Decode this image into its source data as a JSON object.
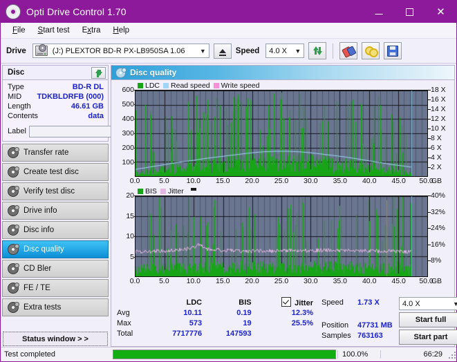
{
  "window": {
    "title": "Opti Drive Control 1.70",
    "icon": "disc-icon",
    "minimize": "–",
    "maximize": "□",
    "close": "✕",
    "accent_color": "#8d1a9b"
  },
  "menu": [
    {
      "label": "File",
      "accel": "F"
    },
    {
      "label": "Start test",
      "accel": "S"
    },
    {
      "label": "Extra",
      "accel": "x"
    },
    {
      "label": "Help",
      "accel": "H"
    }
  ],
  "toolbar": {
    "drive_label": "Drive",
    "drive_value": "(J:)  PLEXTOR BD-R  PX-LB950SA 1.06",
    "drive_icon": "drive-icon",
    "eject_icon": "eject-icon",
    "speed_label": "Speed",
    "speed_value": "4.0 X",
    "refresh_icon": "refresh-icon",
    "erase_icon": "eraser-icon",
    "bitsetting_icon": "bitsetting-icon",
    "save_icon": "save-icon"
  },
  "disc": {
    "title": "Disc",
    "refresh_icon": "refresh-icon",
    "rows": [
      {
        "key": "Type",
        "value": "BD-R DL"
      },
      {
        "key": "MID",
        "value": "TDKBLDRFB (000)"
      },
      {
        "key": "Length",
        "value": "46.61 GB"
      },
      {
        "key": "Contents",
        "value": "data"
      }
    ],
    "label_key": "Label",
    "label_value": "",
    "label_placeholder": "",
    "label_button_icon": "disc-icon"
  },
  "nav": {
    "items": [
      {
        "label": "Transfer rate",
        "icon": "disc-icon",
        "selected": false
      },
      {
        "label": "Create test disc",
        "icon": "disc-icon",
        "selected": false
      },
      {
        "label": "Verify test disc",
        "icon": "disc-icon",
        "selected": false
      },
      {
        "label": "Drive info",
        "icon": "disc-icon",
        "selected": false
      },
      {
        "label": "Disc info",
        "icon": "disc-icon",
        "selected": false
      },
      {
        "label": "Disc quality",
        "icon": "disc-icon",
        "selected": true
      },
      {
        "label": "CD Bler",
        "icon": "disc-icon",
        "selected": false
      },
      {
        "label": "FE / TE",
        "icon": "disc-icon",
        "selected": false
      },
      {
        "label": "Extra tests",
        "icon": "disc-icon",
        "selected": false
      }
    ],
    "status_window": "Status window > >"
  },
  "pane": {
    "title": "Disc quality",
    "icon": "disc-icon"
  },
  "chart_data": [
    {
      "type": "line",
      "title": "LDC / Read speed",
      "legend": [
        {
          "label": "LDC",
          "color": "#17a517"
        },
        {
          "label": "Read speed",
          "color": "#9fd6f5"
        },
        {
          "label": "Write speed",
          "color": "#f48fd8"
        }
      ],
      "legend_position": "top-left",
      "grid": true,
      "xlabel": "GB",
      "x_ticks": [
        "0.0",
        "5.0",
        "10.0",
        "15.0",
        "20.0",
        "25.0",
        "30.0",
        "35.0",
        "40.0",
        "45.0",
        "50.0"
      ],
      "xlim": [
        0,
        50
      ],
      "ylabel_left": "LDC",
      "y_ticks_left": [
        "100",
        "200",
        "300",
        "400",
        "500",
        "600"
      ],
      "ylim_left": [
        0,
        600
      ],
      "ylabel_right": "Speed",
      "y_ticks_right": [
        "2 X",
        "4 X",
        "6 X",
        "8 X",
        "10 X",
        "12 X",
        "14 X",
        "16 X",
        "18 X"
      ],
      "ylim_right": [
        0,
        18
      ],
      "x_unit": "GB",
      "series": [
        {
          "name": "Read speed",
          "color": "#9fd6f5",
          "x": [
            0,
            2,
            4,
            6,
            8,
            10,
            12,
            14,
            16,
            18,
            20,
            22,
            24,
            26,
            28,
            30,
            32,
            34,
            36,
            38,
            40,
            42,
            44,
            46,
            47
          ],
          "values": [
            1.5,
            1.9,
            2.3,
            2.7,
            3.1,
            3.4,
            3.8,
            4.1,
            4.4,
            4.7,
            5.0,
            5.2,
            5.3,
            5.3,
            5.2,
            5.0,
            4.7,
            4.4,
            4.1,
            3.7,
            3.3,
            2.9,
            2.5,
            2.2,
            2.0
          ]
        },
        {
          "name": "LDC",
          "color": "#17a517",
          "note": "dense per-sample error bars, baseline ~10, spikes up to 573"
        }
      ],
      "cursor_x": 47.3,
      "cursor_color": "#29c6f0"
    },
    {
      "type": "line",
      "title": "BIS / Jitter",
      "legend": [
        {
          "label": "BIS",
          "color": "#17a517"
        },
        {
          "label": "Jitter",
          "color": "#e3b7e0"
        }
      ],
      "legend_position": "top-left",
      "grid": true,
      "xlabel": "GB",
      "x_ticks": [
        "0.0",
        "5.0",
        "10.0",
        "15.0",
        "20.0",
        "25.0",
        "30.0",
        "35.0",
        "40.0",
        "45.0",
        "50.0"
      ],
      "xlim": [
        0,
        50
      ],
      "ylabel_left": "BIS",
      "y_ticks_left": [
        "5",
        "10",
        "15",
        "20"
      ],
      "ylim_left": [
        0,
        20
      ],
      "ylabel_right": "Jitter",
      "y_ticks_right": [
        "8%",
        "16%",
        "24%",
        "32%",
        "40%"
      ],
      "ylim_right": [
        0,
        40
      ],
      "x_unit": "GB",
      "series": [
        {
          "name": "Jitter",
          "color": "#e3b7e0",
          "x": [
            0,
            2,
            4,
            6,
            8,
            10,
            11,
            12,
            14,
            16,
            18,
            20,
            22,
            24,
            26,
            28,
            30,
            32,
            34,
            36,
            38,
            40,
            42,
            44,
            46,
            47
          ],
          "values": [
            12.3,
            12.6,
            12.8,
            13.0,
            13.4,
            14.5,
            16.0,
            13.8,
            13.4,
            13.0,
            12.8,
            12.7,
            12.9,
            12.8,
            13.0,
            13.1,
            13.0,
            13.2,
            13.1,
            13.0,
            12.9,
            12.8,
            12.7,
            12.6,
            12.5,
            12.4
          ]
        },
        {
          "name": "BIS",
          "color": "#17a517",
          "note": "dense per-sample bars, baseline ~2, spikes up to 19"
        }
      ],
      "cursor_x": 47.3,
      "cursor_color": "#29c6f0"
    }
  ],
  "stats": {
    "headers": {
      "ldc": "LDC",
      "bis": "BIS",
      "jitter": "Jitter"
    },
    "jitter_checked": true,
    "rows": [
      {
        "key": "Avg",
        "ldc": "10.11",
        "bis": "0.19",
        "jitter": "12.3%"
      },
      {
        "key": "Max",
        "ldc": "573",
        "bis": "19",
        "jitter": "25.5%"
      },
      {
        "key": "Total",
        "ldc": "7717776",
        "bis": "147593",
        "jitter": ""
      }
    ],
    "speed_key": "Speed",
    "speed_value": "1.73 X",
    "position_key": "Position",
    "position_value": "47731 MB",
    "samples_key": "Samples",
    "samples_value": "763163",
    "speed_select": "4.0 X",
    "start_full": "Start full",
    "start_part": "Start part"
  },
  "statusbar": {
    "message": "Test completed",
    "progress_percent": 100,
    "progress_text": "100.0%",
    "elapsed": "66:29",
    "progress_color": "#11ad11"
  }
}
